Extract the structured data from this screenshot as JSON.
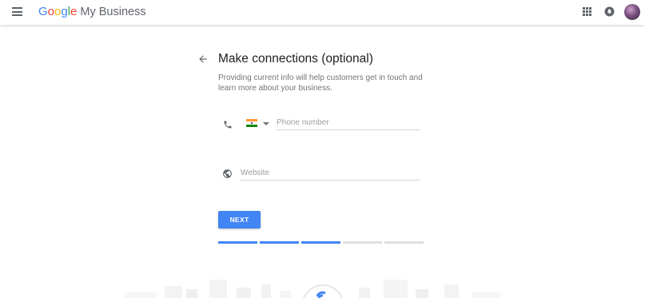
{
  "header": {
    "logo_google": [
      "G",
      "o",
      "o",
      "g",
      "l",
      "e"
    ],
    "logo_product": "My Business",
    "icons": [
      "menu-icon",
      "apps-icon",
      "notifications-icon",
      "account-avatar"
    ],
    "colors": {
      "google_blue": "#4285f4",
      "google_red": "#ea4335",
      "google_yellow": "#fbbc05",
      "google_green": "#34a853"
    }
  },
  "main": {
    "title": "Make connections (optional)",
    "subtitle": "Providing current info will help customers get in touch and learn more about your business.",
    "phone": {
      "country": "India",
      "placeholder": "Phone number",
      "value": ""
    },
    "website": {
      "placeholder": "Website",
      "value": ""
    },
    "next_label": "NEXT",
    "progress": {
      "completed_steps": 3,
      "total_steps": 5
    },
    "accent_color": "#4285f4"
  }
}
